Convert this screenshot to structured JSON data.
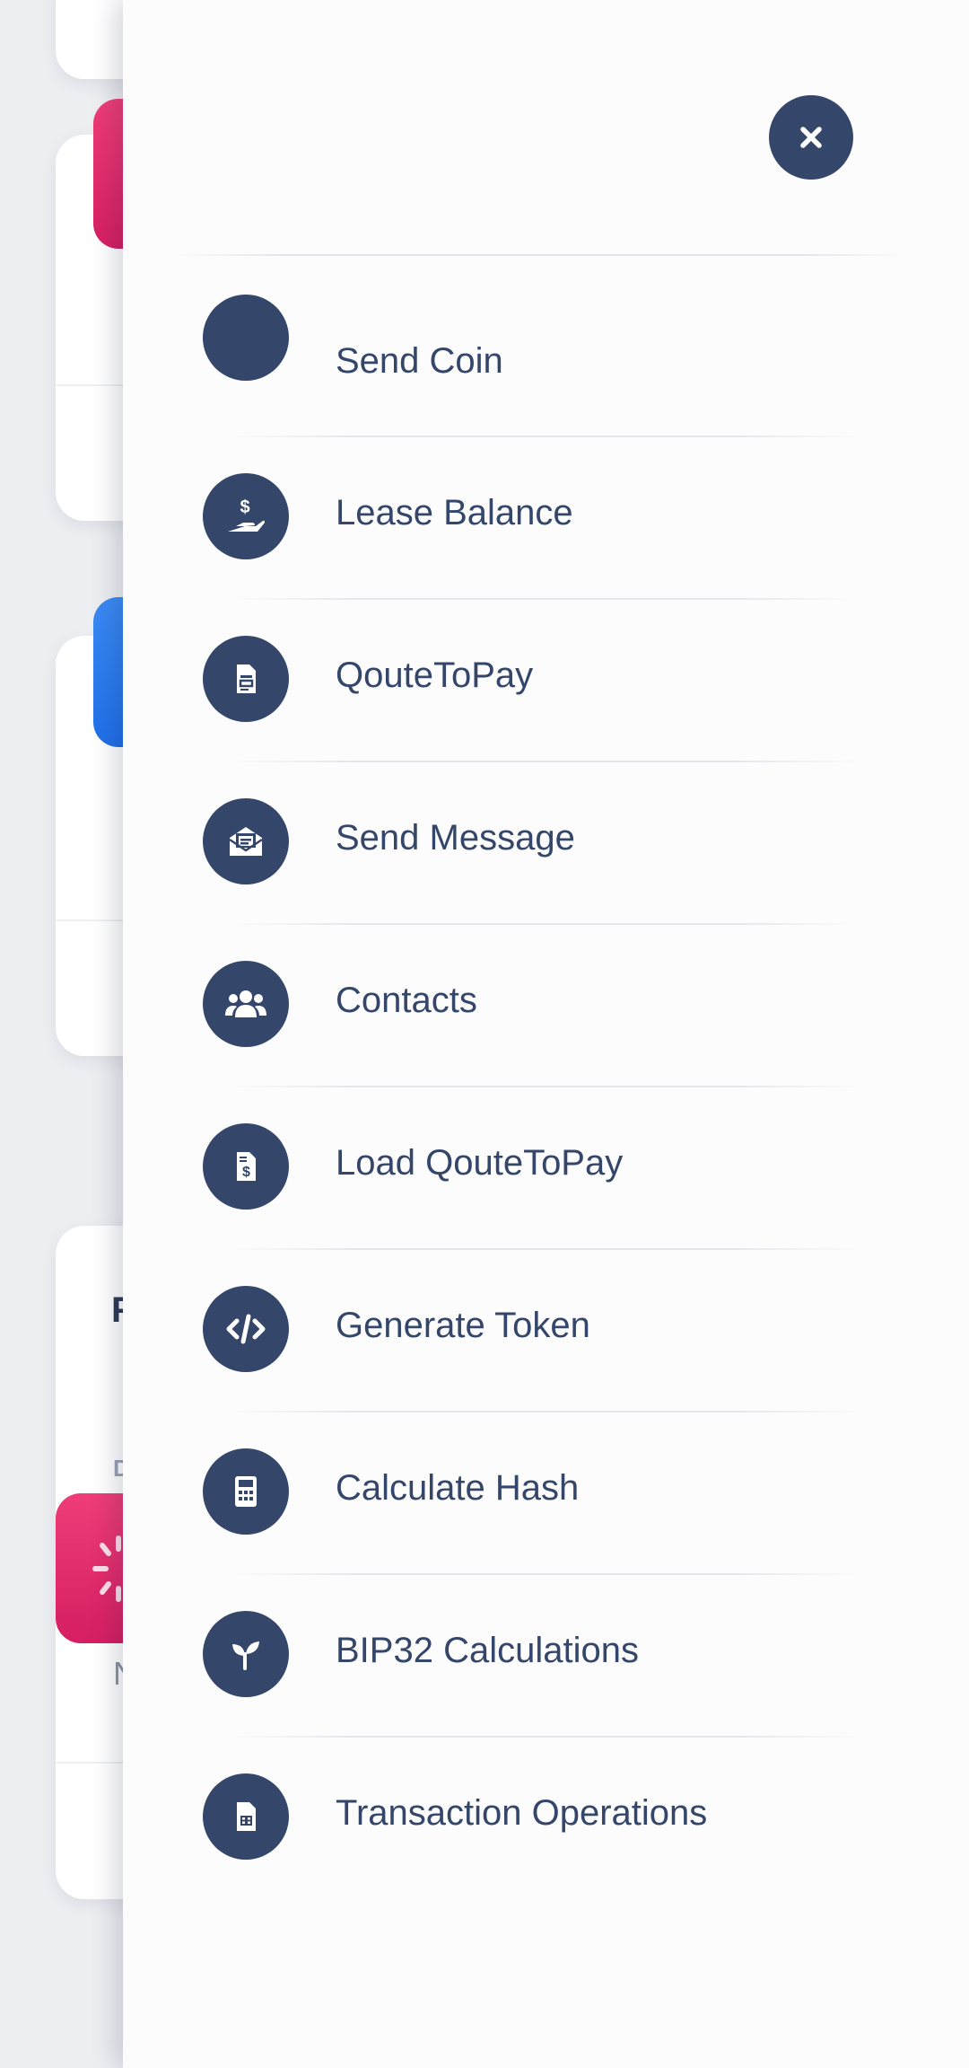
{
  "background": {
    "fragments": {
      "letter_f": "F",
      "letter_d": "D",
      "letter_n": "N"
    },
    "colors": {
      "pink": "#e8306f",
      "blue": "#2f7ff0"
    }
  },
  "drawer": {
    "close_icon": "close-icon",
    "items": [
      {
        "label": "Send Coin",
        "icon": "blank-icon"
      },
      {
        "label": "Lease Balance",
        "icon": "hand-dollar-icon"
      },
      {
        "label": "QouteToPay",
        "icon": "document-icon"
      },
      {
        "label": "Send Message",
        "icon": "envelope-open-icon"
      },
      {
        "label": "Contacts",
        "icon": "users-icon"
      },
      {
        "label": "Load QouteToPay",
        "icon": "file-dollar-icon"
      },
      {
        "label": "Generate Token",
        "icon": "code-icon"
      },
      {
        "label": "Calculate Hash",
        "icon": "calculator-icon"
      },
      {
        "label": "BIP32 Calculations",
        "icon": "seedling-icon"
      },
      {
        "label": "Transaction Operations",
        "icon": "file-table-icon"
      }
    ],
    "colors": {
      "icon_bg": "#34466a",
      "label": "#34466a",
      "drawer_bg": "#fcfcfc"
    }
  }
}
